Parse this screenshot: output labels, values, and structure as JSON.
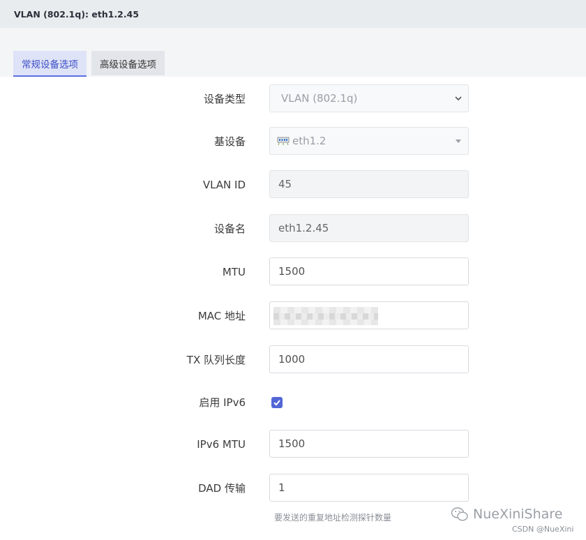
{
  "header": {
    "title": "VLAN (802.1q): eth1.2.45"
  },
  "tabs": [
    {
      "label": "常规设备选项",
      "active": true
    },
    {
      "label": "高级设备选项",
      "active": false
    }
  ],
  "form": {
    "device_type": {
      "label": "设备类型",
      "value": "VLAN (802.1q)"
    },
    "base_device": {
      "label": "基设备",
      "value": "eth1.2"
    },
    "vlan_id": {
      "label": "VLAN ID",
      "value": "45"
    },
    "device_name": {
      "label": "设备名",
      "value": "eth1.2.45"
    },
    "mtu": {
      "label": "MTU",
      "value": "1500"
    },
    "mac": {
      "label": "MAC 地址",
      "value": ""
    },
    "tx_queue": {
      "label": "TX 队列长度",
      "value": "1000"
    },
    "ipv6": {
      "label": "启用 IPv6",
      "checked": true
    },
    "ipv6_mtu": {
      "label": "IPv6 MTU",
      "value": "1500"
    },
    "dad": {
      "label": "DAD 传输",
      "value": "1",
      "hint": "要发送的重复地址检测探针数量"
    }
  },
  "watermark": {
    "main": "NueXiniShare",
    "sub": "CSDN @NueXini"
  },
  "colors": {
    "accent": "#5366d6",
    "tab_active_bg": "#dfe3f7",
    "header_bg": "#e9ecef"
  }
}
